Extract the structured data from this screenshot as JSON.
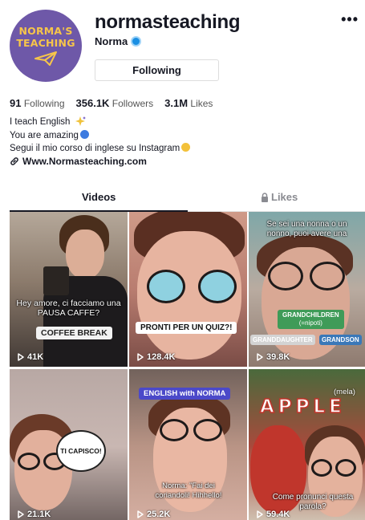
{
  "profile": {
    "avatar_text_line1": "NORMA'S",
    "avatar_text_line2": "TEACHING",
    "username": "normasteaching",
    "display_name": "Norma",
    "follow_button": "Following",
    "more_icon": "more-icon"
  },
  "stats": {
    "following_count": "91",
    "following_label": "Following",
    "followers_count": "356.1K",
    "followers_label": "Followers",
    "likes_count": "3.1M",
    "likes_label": "Likes"
  },
  "bio": {
    "line1": "I teach English",
    "line2": "You are amazing",
    "line3": "Segui il mio corso di inglese su Instagram",
    "link": "Www.Normasteaching.com"
  },
  "tabs": {
    "videos": "Videos",
    "likes": "Likes"
  },
  "videos": [
    {
      "caption": "Hey amore, ci facciamo una PAUSA CAFFE?",
      "tag": "COFFEE BREAK",
      "views": "41K"
    },
    {
      "caption": "",
      "tag": "PRONTI PER UN QUIZ?!",
      "views": "128.4K"
    },
    {
      "caption": "Se sei una nonna o un nonno, puoi avere una",
      "tag_center": "GRANDCHILDREN",
      "tag_sub": "(=nipoti)",
      "tag_left": "GRANDDAUGHTER",
      "tag_right": "GRANDSON",
      "views": "39.8K"
    },
    {
      "caption": "",
      "tag": "TI CAPISCO!",
      "views": "21.1K"
    },
    {
      "caption": "Norma: \"Fai dei coriandoli! Hihhello!",
      "tag": "ENGLISH with NORMA",
      "views": "25.2K"
    },
    {
      "caption": "Come pronunci questa parola?",
      "tag": "APPLE",
      "tag_sub": "(mela)",
      "views": "59.4K"
    }
  ],
  "colors": {
    "avatar_bg": "#6e58a8",
    "avatar_text": "#f6c54a",
    "verified": "#1b8fe3"
  }
}
